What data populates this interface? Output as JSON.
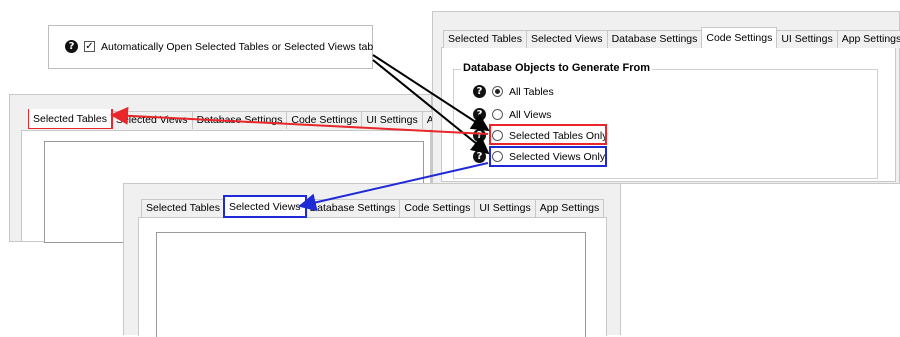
{
  "callout": {
    "checkbox_label": "Automatically Open Selected Tables or Selected Views tab",
    "checked": true
  },
  "tabs": [
    "Selected Tables",
    "Selected Views",
    "Database Settings",
    "Code Settings",
    "UI Settings",
    "App Settings"
  ],
  "left_panel": {
    "tab_labels": [
      "Selected Tables",
      "Selected Views",
      "Database Settings",
      "Code Settings",
      "UI Settings",
      "App"
    ]
  },
  "code_settings": {
    "group_title": "Database Objects to Generate From",
    "options": [
      {
        "label": "All Tables",
        "checked": true
      },
      {
        "label": "All Views",
        "checked": false
      },
      {
        "label": "Selected Tables Only",
        "checked": false
      },
      {
        "label": "Selected Views Only",
        "checked": false
      }
    ]
  },
  "colors": {
    "red_highlight": "#e8262b",
    "blue_highlight": "#1f2ad6",
    "arrow_black": "#000000"
  }
}
